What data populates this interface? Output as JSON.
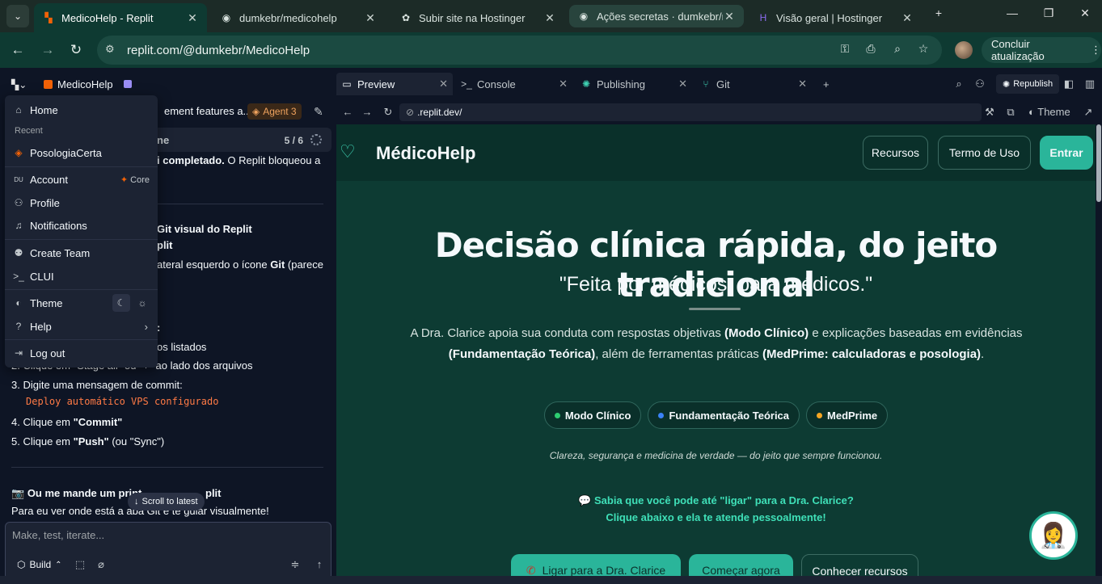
{
  "browser": {
    "tabs": [
      {
        "label": "MedicoHelp - Replit",
        "icon": "replit-icon",
        "active": true
      },
      {
        "label": "dumkebr/medicohelp",
        "icon": "github-icon"
      },
      {
        "label": "Subir site na Hostinger",
        "icon": "openai-icon"
      },
      {
        "label": "Ações secretas · dumkebr/m",
        "icon": "github-icon"
      },
      {
        "label": "Visão geral | Hostinger",
        "icon": "hostinger-icon"
      }
    ],
    "url": "replit.com/@dumkebr/MedicoHelp",
    "update_label": "Concluir atualização"
  },
  "replit": {
    "app_name": "MedicoHelp",
    "chat_title": "ement features a...",
    "agent_badge": "Agent 3",
    "progress_label": "ne",
    "progress_count": "5 / 6",
    "messages": {
      "line1_bold": "i completado.",
      "line1_rest": " O Replit bloqueou a",
      "git_title1": "Git visual do Replit",
      "git_title2": "plit",
      "git_line": "ateral esquerdo o ícone ",
      "git_bold": "Git",
      "git_line_end": " (parece",
      "colon": ":",
      "listed": "os listados",
      "step2": "2. Clique em \"Stage all\" ou \"+\" ao lado dos arquivos",
      "step3": "3. Digite uma mensagem de commit:",
      "commit_msg": "Deploy automático VPS configurado",
      "step4_pre": "4. Clique em ",
      "step4_bold": "\"Commit\"",
      "step5_pre": "5. Clique em ",
      "step5_bold": "\"Push\"",
      "step5_post": " (ou \"Sync\")",
      "final_bold": "Ou me mande um print",
      "final_bold2": "plit",
      "final_line": "Para eu ver onde está a aba Git e te guiar visualmente!"
    },
    "scroll_label": "Scroll to latest",
    "input_placeholder": "Make, test, iterate...",
    "build_label": "Build",
    "menu": {
      "home": "Home",
      "recent_label": "Recent",
      "recent_item": "PosologiaCerta",
      "account": "Account",
      "core": "Core",
      "profile": "Profile",
      "notifications": "Notifications",
      "create_team": "Create Team",
      "clui": "CLUI",
      "theme": "Theme",
      "help": "Help",
      "logout": "Log out"
    },
    "panel_tabs": [
      "Preview",
      "Console",
      "Publishing",
      "Git"
    ],
    "republish": "Republish",
    "preview_url": ".replit.dev/",
    "theme_link": "Theme"
  },
  "site": {
    "brand": "MédicoHelp",
    "nav": [
      "Recursos",
      "Termo de Uso",
      "Entrar"
    ],
    "hero_title": "Decisão clínica rápida, do jeito tradicional",
    "hero_sub": "\"Feita por médicos, para médicos.\"",
    "desc": {
      "p1": "A Dra. Clarice apoia sua conduta com respostas objetivas ",
      "b1": "(Modo Clínico)",
      "p2": " e explicações baseadas em evidências ",
      "b2": "(Fundamentação Teórica)",
      "p3": ", além de ferramentas práticas ",
      "b3": "(MedPrime: calculadoras e posologia)",
      "p4": "."
    },
    "chips": [
      {
        "label": "Modo Clínico",
        "color": "#2ecc71"
      },
      {
        "label": "Fundamentação Teórica",
        "color": "#3b82f6"
      },
      {
        "label": "MedPrime",
        "color": "#f5a623"
      }
    ],
    "tagline": "Clareza, segurança e medicina de verdade — do jeito que sempre funcionou.",
    "callout1": "Sabia que você pode até \"ligar\" para a Dra. Clarice?",
    "callout2": "Clique abaixo e ela te atende pessoalmente!",
    "ctas": [
      "Ligar para a Dra. Clarice",
      "Começar agora",
      "Conhecer recursos"
    ]
  },
  "colors": {
    "accent": "#2ab59a",
    "bg": "#0d3b33",
    "replit_orange": "#f26207"
  }
}
